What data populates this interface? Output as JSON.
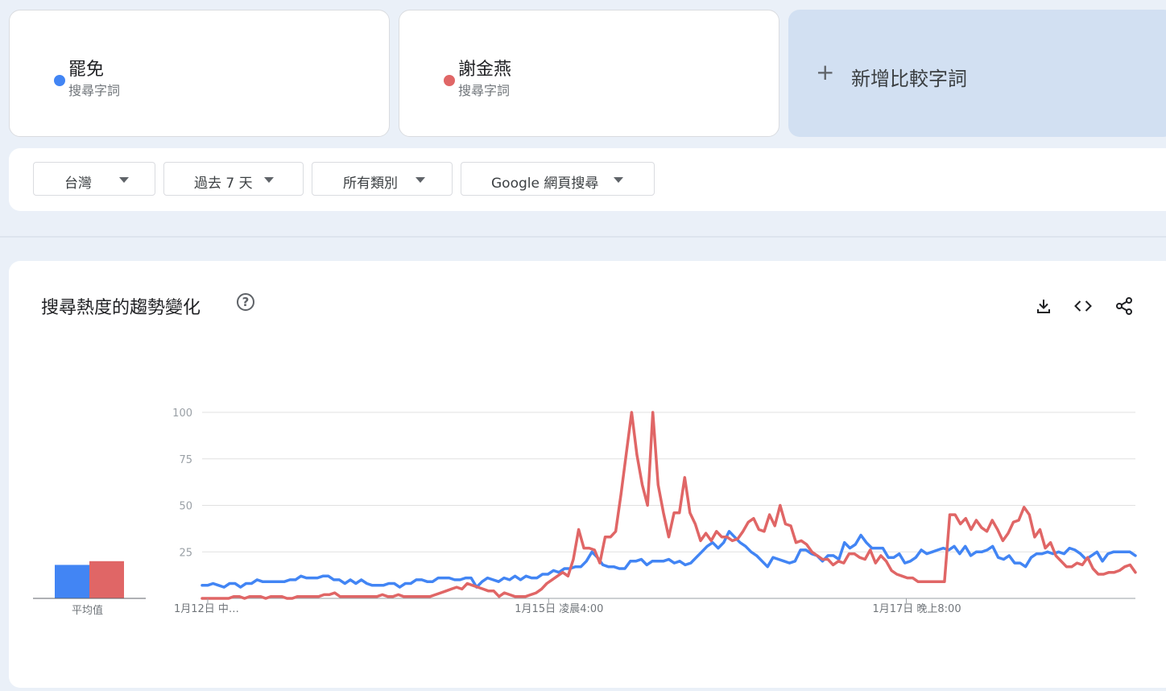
{
  "terms": [
    {
      "name": "罷免",
      "sub": "搜尋字詞",
      "color": "#4285f4"
    },
    {
      "name": "謝金燕",
      "sub": "搜尋字詞",
      "color": "#e06666"
    }
  ],
  "add_compare": {
    "label": "新增比較字詞",
    "icon": "plus-icon"
  },
  "filters": [
    {
      "label": "台灣"
    },
    {
      "label": "過去 7 天"
    },
    {
      "label": "所有類別"
    },
    {
      "label": "Google 網頁搜尋"
    }
  ],
  "chart": {
    "title": "搜尋熱度的趨勢變化",
    "help_icon": "question-circle-icon",
    "toolbar": [
      "download-icon",
      "embed-code-icon",
      "share-icon"
    ],
    "average_label": "平均值"
  },
  "chart_data": {
    "type": "line",
    "ylim": [
      0,
      100
    ],
    "y_ticks": [
      100,
      75,
      50,
      25
    ],
    "x_range": [
      0,
      167
    ],
    "x_ticks": [
      {
        "x": 1,
        "label": "1月12日 中…"
      },
      {
        "x": 62,
        "label": "1月15日 凌晨4:00"
      },
      {
        "x": 126,
        "label": "1月17日 晚上8:00"
      }
    ],
    "grid": true,
    "averages": [
      18,
      20
    ],
    "series": [
      {
        "name": "罷免",
        "color": "#4285f4",
        "values": [
          7,
          7,
          8,
          7,
          6,
          8,
          8,
          6,
          8,
          8,
          10,
          9,
          9,
          9,
          9,
          9,
          10,
          10,
          12,
          11,
          11,
          11,
          12,
          12,
          10,
          10,
          8,
          10,
          8,
          10,
          8,
          7,
          7,
          7,
          8,
          8,
          6,
          8,
          8,
          10,
          10,
          9,
          9,
          11,
          11,
          11,
          10,
          10,
          11,
          11,
          6,
          9,
          11,
          10,
          9,
          11,
          10,
          12,
          10,
          12,
          11,
          11,
          13,
          13,
          15,
          14,
          16,
          16,
          17,
          17,
          20,
          25,
          22,
          18,
          17,
          17,
          16,
          16,
          20,
          20,
          21,
          18,
          20,
          20,
          20,
          21,
          19,
          20,
          18,
          19,
          22,
          25,
          28,
          30,
          27,
          30,
          36,
          33,
          30,
          28,
          25,
          23,
          20,
          17,
          22,
          21,
          20,
          19,
          20,
          26,
          26,
          24,
          23,
          20,
          23,
          23,
          21,
          30,
          27,
          29,
          34,
          30,
          27,
          27,
          27,
          22,
          22,
          24,
          19,
          20,
          22,
          26,
          24,
          25,
          26,
          27,
          26,
          28,
          24,
          28,
          23,
          25,
          25,
          26,
          28,
          22,
          21,
          23,
          19,
          19,
          17,
          22,
          24,
          24,
          25,
          24,
          25,
          24,
          27,
          26,
          24,
          21,
          23,
          25,
          20,
          24,
          25,
          25,
          25,
          25,
          23
        ]
      },
      {
        "name": "謝金燕",
        "color": "#e06666",
        "values": [
          0,
          0,
          0,
          0,
          0,
          0,
          1,
          1,
          0,
          1,
          1,
          1,
          0,
          1,
          1,
          1,
          0,
          0,
          1,
          1,
          1,
          1,
          1,
          2,
          2,
          3,
          1,
          1,
          1,
          1,
          1,
          1,
          1,
          1,
          2,
          1,
          1,
          2,
          1,
          1,
          1,
          1,
          1,
          1,
          2,
          3,
          4,
          5,
          6,
          5,
          8,
          7,
          6,
          5,
          4,
          4,
          1,
          3,
          2,
          1,
          1,
          1,
          2,
          3,
          5,
          8,
          10,
          12,
          14,
          12,
          21,
          37,
          27,
          27,
          26,
          19,
          33,
          33,
          36,
          56,
          78,
          100,
          77,
          61,
          50,
          100,
          61,
          46,
          33,
          46,
          46,
          65,
          46,
          40,
          31,
          35,
          31,
          36,
          33,
          33,
          31,
          32,
          36,
          41,
          43,
          37,
          36,
          45,
          39,
          50,
          40,
          39,
          30,
          31,
          29,
          25,
          23,
          21,
          21,
          18,
          20,
          19,
          24,
          24,
          22,
          21,
          26,
          19,
          23,
          20,
          15,
          13,
          12,
          11,
          11,
          9,
          9,
          9,
          9,
          9,
          9,
          45,
          45,
          40,
          43,
          37,
          42,
          38,
          36,
          42,
          37,
          31,
          35,
          41,
          42,
          49,
          45,
          33,
          37,
          27,
          30,
          23,
          20,
          17,
          17,
          19,
          18,
          22,
          16,
          13,
          13,
          14,
          14,
          15,
          17,
          18,
          14
        ]
      }
    ]
  }
}
